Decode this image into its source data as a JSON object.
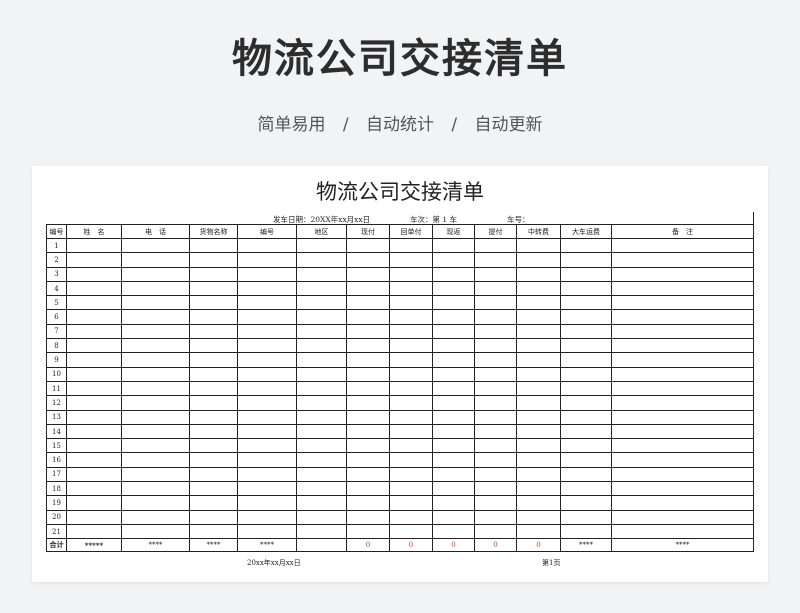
{
  "header": {
    "title": "物流公司交接清单",
    "subtitle": [
      "简单易用",
      "自动统计",
      "自动更新"
    ],
    "separator": "/"
  },
  "sheet": {
    "title": "物流公司交接清单",
    "info": {
      "date": "发车日期：20XX年xx月xx日",
      "trip": "车次：第 1 车",
      "plate": "车号："
    },
    "columns": [
      "编号",
      "姓　名",
      "电　话",
      "货物名称",
      "编号",
      "地区",
      "现付",
      "回单付",
      "现返",
      "提付",
      "中转费",
      "大车运费",
      "备　注"
    ],
    "row_numbers": [
      "1",
      "2",
      "3",
      "4",
      "5",
      "6",
      "7",
      "8",
      "9",
      "10",
      "11",
      "12",
      "13",
      "14",
      "15",
      "16",
      "17",
      "18",
      "19",
      "20",
      "21"
    ],
    "total_row": [
      "合计",
      "*****",
      "****",
      "****",
      "****",
      "",
      "0",
      "0",
      "0",
      "0",
      "0",
      "****",
      "****",
      ""
    ],
    "footer": {
      "date": "20xx年xx月xx日",
      "page": "第1页"
    },
    "colors": {
      "zero_value": "#e23c2c",
      "grid": "#222222"
    }
  }
}
